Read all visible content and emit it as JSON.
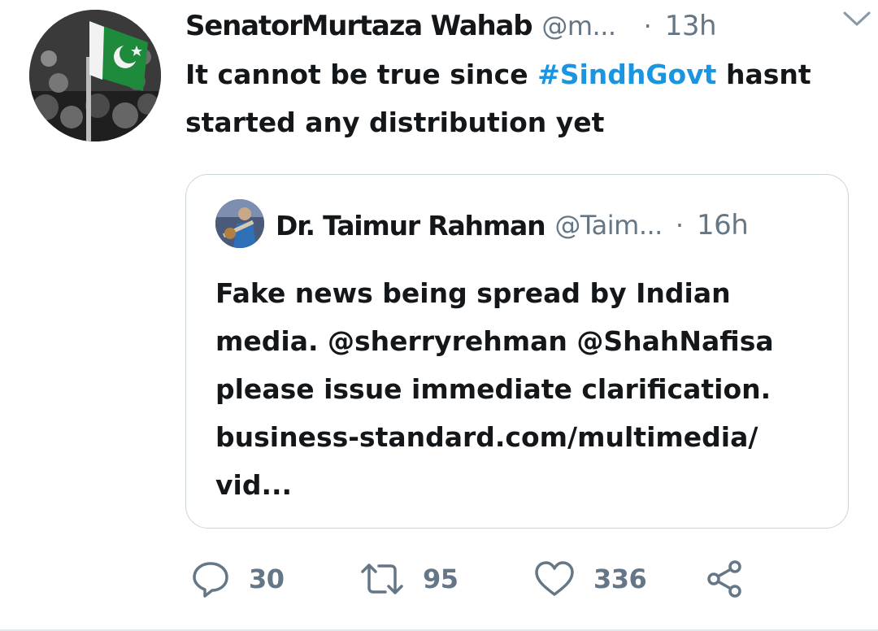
{
  "tweet": {
    "display_name": "SenatorMurtaza Wahab",
    "handle": "@m...",
    "separator": "·",
    "time": "13h",
    "body": {
      "prefix": "It cannot be true since ",
      "hashtag": "#SindhGovt",
      "suffix": " hasnt started any distribution yet"
    },
    "avatar_icon": "flag-crowd-avatar",
    "caret_icon": "chevron-down-icon"
  },
  "quoted_tweet": {
    "display_name": "Dr. Taimur Rahman",
    "handle": "@Taim...",
    "separator": "·",
    "time": "16h",
    "avatar_icon": "guitarist-avatar",
    "body_lines": [
      "Fake news being spread by Indian",
      "media. @sherryrehman @ShahNafisa",
      "please issue immediate clarification.",
      "business-standard.com/multimedia/",
      "vid..."
    ]
  },
  "actions": {
    "reply": {
      "icon": "reply-icon",
      "count": "30"
    },
    "retweet": {
      "icon": "retweet-icon",
      "count": "95"
    },
    "like": {
      "icon": "heart-icon",
      "count": "336"
    },
    "share": {
      "icon": "share-icon"
    }
  },
  "colors": {
    "text": "#14171a",
    "secondary": "#657786",
    "link": "#1b95e0",
    "border": "#ccd6dd",
    "flag_green": "#1e8a3c"
  }
}
